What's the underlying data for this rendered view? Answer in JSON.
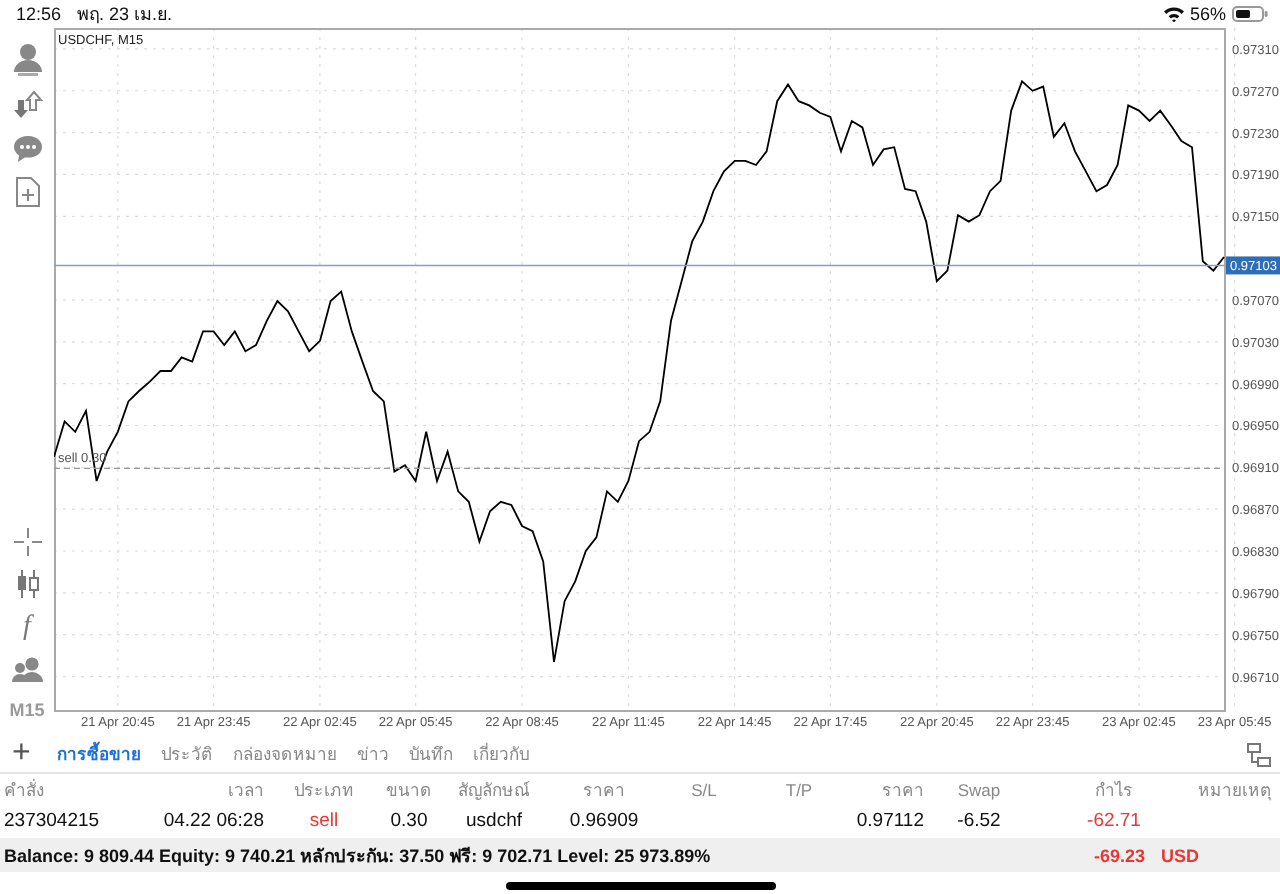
{
  "status_bar": {
    "time": "12:56",
    "date": "พฤ. 23 เม.ย.",
    "battery_text": "56%"
  },
  "sidebar": {
    "indicator_glyph": "f",
    "timeframe": "M15"
  },
  "chart": {
    "chart_data": {
      "type": "line",
      "title": "USDCHF, M15",
      "grid": true,
      "categories": [
        null,
        null,
        null,
        null,
        null,
        null,
        "21 Apr 20:45",
        null,
        null,
        null,
        null,
        null,
        null,
        null,
        null,
        "21 Apr 23:45",
        null,
        null,
        null,
        null,
        null,
        null,
        null,
        null,
        null,
        "22 Apr 02:45",
        null,
        null,
        null,
        null,
        null,
        null,
        null,
        null,
        "22 Apr 05:45",
        null,
        null,
        null,
        null,
        null,
        null,
        null,
        null,
        null,
        "22 Apr 08:45",
        null,
        null,
        null,
        null,
        null,
        null,
        null,
        null,
        null,
        "22 Apr 11:45",
        null,
        null,
        null,
        null,
        null,
        null,
        null,
        null,
        null,
        "22 Apr 14:45",
        null,
        null,
        null,
        null,
        null,
        null,
        null,
        null,
        "22 Apr 17:45",
        null,
        null,
        null,
        null,
        null,
        null,
        null,
        null,
        null,
        "22 Apr 20:45",
        null,
        null,
        null,
        null,
        null,
        null,
        null,
        null,
        "22 Apr 23:45",
        null,
        null,
        null,
        null,
        null,
        null,
        null,
        null,
        null,
        "23 Apr 02:45",
        null,
        null,
        null,
        null,
        null,
        null,
        null,
        null,
        "23 Apr 05:45"
      ],
      "ylim": [
        0.96678,
        0.9733
      ],
      "yticks": [
        {
          "value": 0.9731,
          "label": "0.97310"
        },
        {
          "value": 0.9727,
          "label": "0.97270"
        },
        {
          "value": 0.9723,
          "label": "0.97230"
        },
        {
          "value": 0.9719,
          "label": "0.97190"
        },
        {
          "value": 0.9715,
          "label": "0.97150"
        },
        {
          "value": 0.9707,
          "label": "0.97070"
        },
        {
          "value": 0.9703,
          "label": "0.97030"
        },
        {
          "value": 0.9699,
          "label": "0.96990"
        },
        {
          "value": 0.9695,
          "label": "0.96950"
        },
        {
          "value": 0.9691,
          "label": "0.96910"
        },
        {
          "value": 0.9687,
          "label": "0.96870"
        },
        {
          "value": 0.9683,
          "label": "0.96830"
        },
        {
          "value": 0.9679,
          "label": "0.96790"
        },
        {
          "value": 0.9675,
          "label": "0.96750"
        },
        {
          "value": 0.9671,
          "label": "0.96710"
        }
      ],
      "series": [
        {
          "color": "#000000",
          "values": [
            0.9692,
            0.96954,
            0.96944,
            0.96964,
            0.96897,
            0.96925,
            0.96944,
            0.96973,
            0.96983,
            0.96992,
            0.97002,
            0.97002,
            0.97015,
            0.97011,
            0.9704,
            0.9704,
            0.97027,
            0.9704,
            0.97021,
            0.97027,
            0.9705,
            0.97069,
            0.97059,
            0.9704,
            0.97021,
            0.97031,
            0.97069,
            0.97078,
            0.9704,
            0.97011,
            0.96983,
            0.96973,
            0.96906,
            0.96912,
            0.96897,
            0.96944,
            0.96897,
            0.96925,
            0.96887,
            0.96877,
            0.96839,
            0.96868,
            0.96877,
            0.96874,
            0.96854,
            0.96849,
            0.9682,
            0.96724,
            0.96782,
            0.96801,
            0.9683,
            0.96843,
            0.96887,
            0.96877,
            0.96897,
            0.96935,
            0.96944,
            0.96973,
            0.9705,
            0.97088,
            0.97126,
            0.97145,
            0.97174,
            0.97193,
            0.97203,
            0.97203,
            0.97199,
            0.97212,
            0.9726,
            0.97276,
            0.9726,
            0.97256,
            0.97249,
            0.97245,
            0.97212,
            0.97241,
            0.97235,
            0.97199,
            0.97214,
            0.97216,
            0.97176,
            0.97174,
            0.97145,
            0.97088,
            0.97098,
            0.97151,
            0.97145,
            0.97151,
            0.97174,
            0.97184,
            0.97251,
            0.97279,
            0.9727,
            0.97274,
            0.97226,
            0.97239,
            0.97212,
            0.97193,
            0.97174,
            0.9718,
            0.97199,
            0.97256,
            0.97251,
            0.97241,
            0.97251,
            0.97237,
            0.97222,
            0.97216,
            0.97107,
            0.97098,
            0.97111,
            null
          ]
        }
      ],
      "ref_lines": [
        {
          "axis": "y",
          "value": 0.96909,
          "label": "sell 0.30",
          "color": "#999999"
        },
        {
          "axis": "y",
          "value": 0.97103,
          "label": "0.97103",
          "color": "#8aa0b8"
        }
      ]
    }
  },
  "tabs": [
    {
      "label": "การซื้อขาย",
      "selected": true
    },
    {
      "label": "ประวัติ",
      "selected": false
    },
    {
      "label": "กล่องจดหมาย",
      "selected": false
    },
    {
      "label": "ข่าว",
      "selected": false
    },
    {
      "label": "บันทึก",
      "selected": false
    },
    {
      "label": "เกี่ยวกับ",
      "selected": false
    }
  ],
  "add_button": "+",
  "table": {
    "columns": [
      "คำสั่ง",
      "เวลา",
      "ประเภท",
      "ขนาด",
      "สัญลักษณ์",
      "ราคา",
      "S/L",
      "T/P",
      "ราคา",
      "Swap",
      "กำไร",
      "หมายเหตุ"
    ],
    "rows": [
      {
        "order": "237304215",
        "time": "04.22 06:28",
        "type": "sell",
        "type_highlight": true,
        "size": "0.30",
        "symbol": "usdchf",
        "open_price": "0.96909",
        "price": "0.97112",
        "swap": "-6.52",
        "profit": "-62.71",
        "profit_negative": true
      }
    ],
    "summary": {
      "text": "Balance: 9 809.44 Equity: 9 740.21 หลักประกัน: 37.50 ฟรี: 9 702.71 Level: 25 973.89%",
      "total": "-69.23",
      "currency": "USD",
      "total_negative": true
    }
  }
}
